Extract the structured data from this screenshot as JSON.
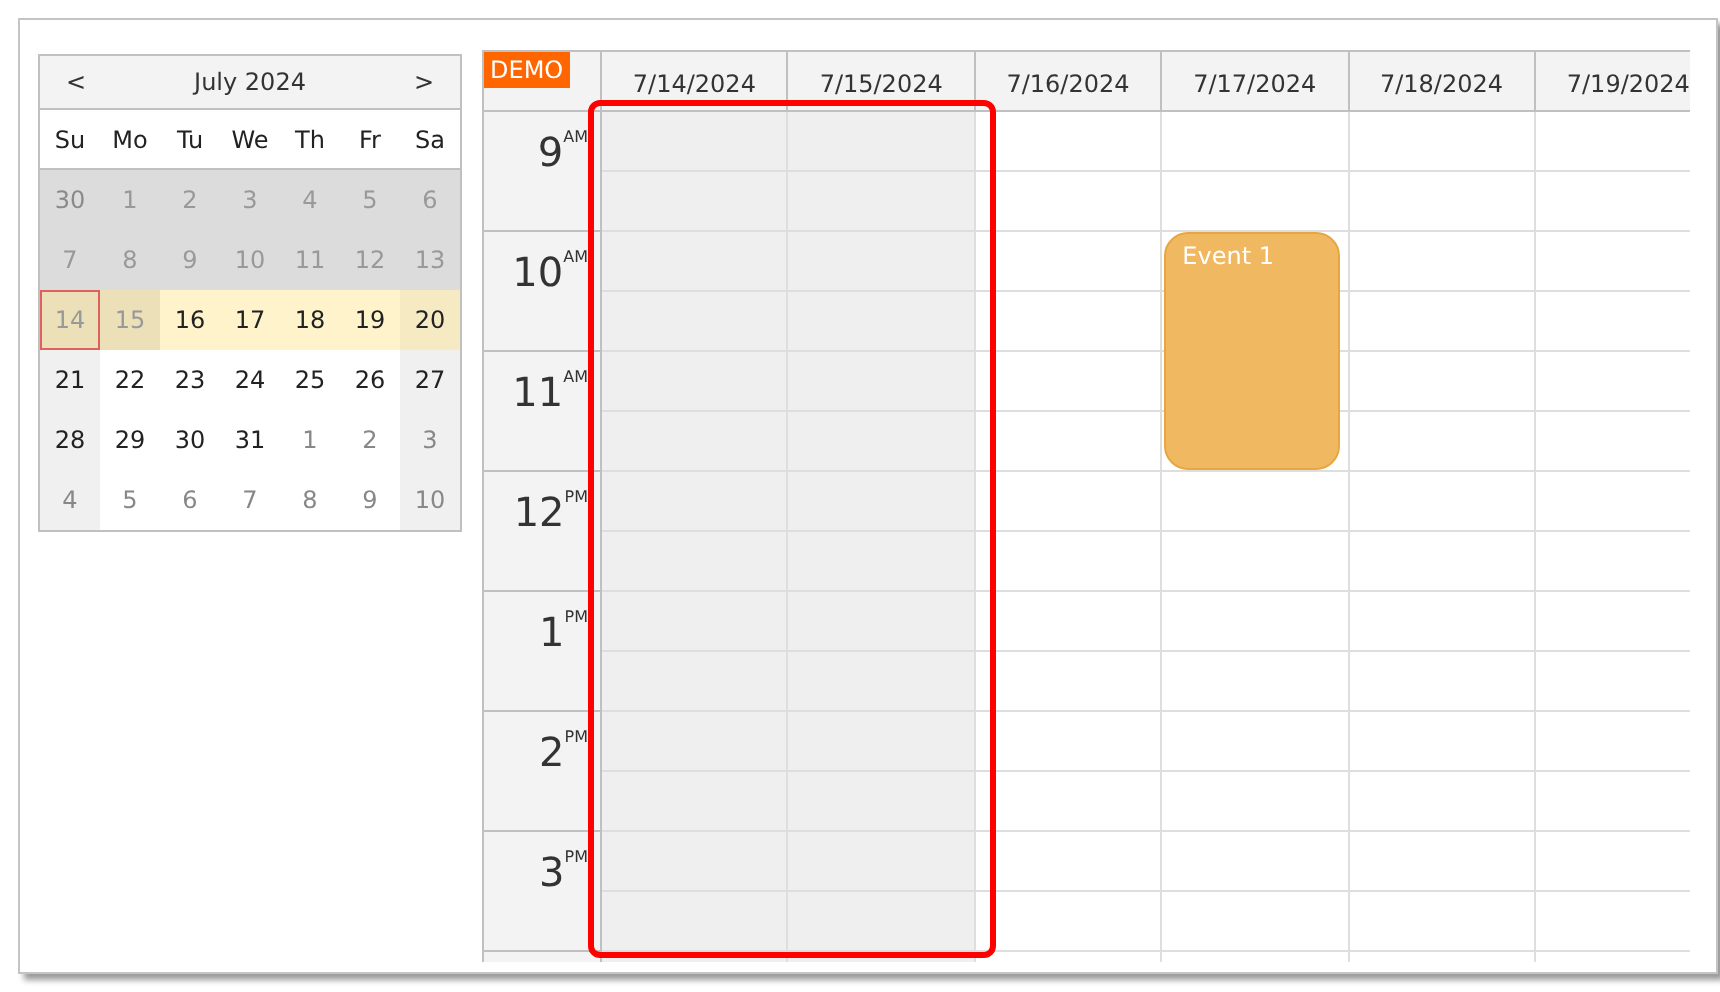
{
  "navigator": {
    "prev": "<",
    "title": "July 2024",
    "next": ">",
    "weekdays": [
      "Su",
      "Mo",
      "Tu",
      "We",
      "Th",
      "Fr",
      "Sa"
    ],
    "weeks": [
      [
        {
          "day": "30",
          "other_month": true,
          "disabled": true,
          "selected": false,
          "today": false
        },
        {
          "day": "1",
          "other_month": false,
          "disabled": true,
          "selected": false,
          "today": false
        },
        {
          "day": "2",
          "other_month": false,
          "disabled": true,
          "selected": false,
          "today": false
        },
        {
          "day": "3",
          "other_month": false,
          "disabled": true,
          "selected": false,
          "today": false
        },
        {
          "day": "4",
          "other_month": false,
          "disabled": true,
          "selected": false,
          "today": false
        },
        {
          "day": "5",
          "other_month": false,
          "disabled": true,
          "selected": false,
          "today": false
        },
        {
          "day": "6",
          "other_month": false,
          "disabled": true,
          "selected": false,
          "today": false
        }
      ],
      [
        {
          "day": "7",
          "other_month": false,
          "disabled": true,
          "selected": false,
          "today": false
        },
        {
          "day": "8",
          "other_month": false,
          "disabled": true,
          "selected": false,
          "today": false
        },
        {
          "day": "9",
          "other_month": false,
          "disabled": true,
          "selected": false,
          "today": false
        },
        {
          "day": "10",
          "other_month": false,
          "disabled": true,
          "selected": false,
          "today": false
        },
        {
          "day": "11",
          "other_month": false,
          "disabled": true,
          "selected": false,
          "today": false
        },
        {
          "day": "12",
          "other_month": false,
          "disabled": true,
          "selected": false,
          "today": false
        },
        {
          "day": "13",
          "other_month": false,
          "disabled": true,
          "selected": false,
          "today": false
        }
      ],
      [
        {
          "day": "14",
          "other_month": false,
          "disabled": true,
          "selected": true,
          "today": true
        },
        {
          "day": "15",
          "other_month": false,
          "disabled": true,
          "selected": true,
          "today": false
        },
        {
          "day": "16",
          "other_month": false,
          "disabled": false,
          "selected": true,
          "today": false
        },
        {
          "day": "17",
          "other_month": false,
          "disabled": false,
          "selected": true,
          "today": false
        },
        {
          "day": "18",
          "other_month": false,
          "disabled": false,
          "selected": true,
          "today": false
        },
        {
          "day": "19",
          "other_month": false,
          "disabled": false,
          "selected": true,
          "today": false
        },
        {
          "day": "20",
          "other_month": false,
          "disabled": false,
          "selected": true,
          "today": false
        }
      ],
      [
        {
          "day": "21",
          "other_month": false,
          "disabled": false,
          "selected": false,
          "today": false
        },
        {
          "day": "22",
          "other_month": false,
          "disabled": false,
          "selected": false,
          "today": false
        },
        {
          "day": "23",
          "other_month": false,
          "disabled": false,
          "selected": false,
          "today": false
        },
        {
          "day": "24",
          "other_month": false,
          "disabled": false,
          "selected": false,
          "today": false
        },
        {
          "day": "25",
          "other_month": false,
          "disabled": false,
          "selected": false,
          "today": false
        },
        {
          "day": "26",
          "other_month": false,
          "disabled": false,
          "selected": false,
          "today": false
        },
        {
          "day": "27",
          "other_month": false,
          "disabled": false,
          "selected": false,
          "today": false
        }
      ],
      [
        {
          "day": "28",
          "other_month": false,
          "disabled": false,
          "selected": false,
          "today": false
        },
        {
          "day": "29",
          "other_month": false,
          "disabled": false,
          "selected": false,
          "today": false
        },
        {
          "day": "30",
          "other_month": false,
          "disabled": false,
          "selected": false,
          "today": false
        },
        {
          "day": "31",
          "other_month": false,
          "disabled": false,
          "selected": false,
          "today": false
        },
        {
          "day": "1",
          "other_month": true,
          "disabled": false,
          "selected": false,
          "today": false
        },
        {
          "day": "2",
          "other_month": true,
          "disabled": false,
          "selected": false,
          "today": false
        },
        {
          "day": "3",
          "other_month": true,
          "disabled": false,
          "selected": false,
          "today": false
        }
      ],
      [
        {
          "day": "4",
          "other_month": true,
          "disabled": false,
          "selected": false,
          "today": false
        },
        {
          "day": "5",
          "other_month": true,
          "disabled": false,
          "selected": false,
          "today": false
        },
        {
          "day": "6",
          "other_month": true,
          "disabled": false,
          "selected": false,
          "today": false
        },
        {
          "day": "7",
          "other_month": true,
          "disabled": false,
          "selected": false,
          "today": false
        },
        {
          "day": "8",
          "other_month": true,
          "disabled": false,
          "selected": false,
          "today": false
        },
        {
          "day": "9",
          "other_month": true,
          "disabled": false,
          "selected": false,
          "today": false
        },
        {
          "day": "10",
          "other_month": true,
          "disabled": false,
          "selected": false,
          "today": false
        }
      ]
    ]
  },
  "calendar": {
    "corner_badge": "DEMO",
    "columns": [
      {
        "date": "7/14/2024",
        "disabled": true
      },
      {
        "date": "7/15/2024",
        "disabled": true
      },
      {
        "date": "7/16/2024",
        "disabled": false
      },
      {
        "date": "7/17/2024",
        "disabled": false,
        "hours": [
          {
            "busy": false
          },
          {
            "busy": true,
            "event": "Event 1"
          },
          {
            "busy": true
          },
          {
            "busy": false
          },
          {
            "busy": false
          },
          {
            "busy": false
          },
          {
            "busy": false
          }
        ]
      },
      {
        "date": "7/18/2024",
        "disabled": false
      },
      {
        "date": "7/19/2024",
        "disabled": false
      }
    ],
    "hours": [
      {
        "hour": "9",
        "period": "AM"
      },
      {
        "hour": "10",
        "period": "AM"
      },
      {
        "hour": "11",
        "period": "AM"
      },
      {
        "hour": "12",
        "period": "PM"
      },
      {
        "hour": "1",
        "period": "PM"
      },
      {
        "hour": "2",
        "period": "PM"
      },
      {
        "hour": "3",
        "period": "PM"
      }
    ]
  }
}
